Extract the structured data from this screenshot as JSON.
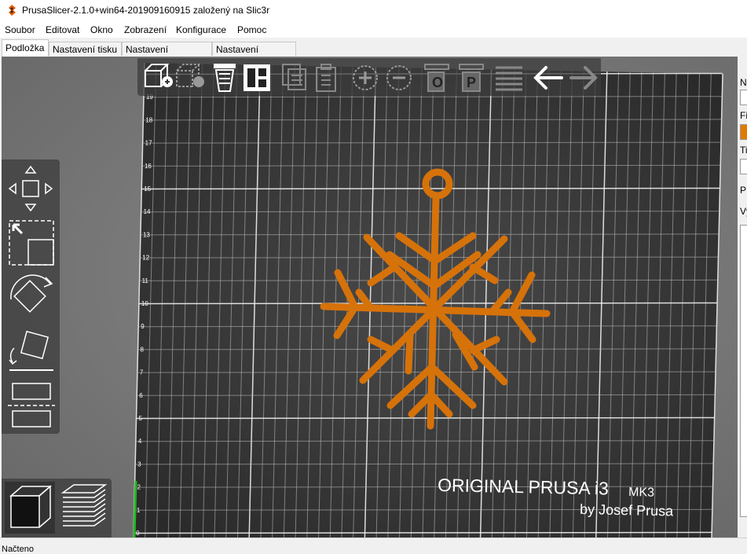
{
  "window": {
    "title": "PrusaSlicer-2.1.0+win64-201909160915 založený na Slic3r",
    "app_icon": "prusaslicer-logo-icon"
  },
  "menu": [
    "Soubor",
    "Editovat",
    "Okno",
    "Zobrazení",
    "Konfigurace",
    "Pomoc"
  ],
  "tabs": [
    {
      "label": "Podložka",
      "active": true
    },
    {
      "label": "Nastavení tisku",
      "active": false
    },
    {
      "label": "Nastavení filamentu",
      "active": false
    },
    {
      "label": "Nastavení tiskárny",
      "active": false
    }
  ],
  "bed": {
    "logo_main": "ORIGINAL PRUSA i3",
    "logo_model": "MK3",
    "logo_sub": "by Josef Prusa",
    "y_ticks": [
      "0",
      "1",
      "2",
      "3",
      "4",
      "5",
      "6",
      "7",
      "8",
      "9",
      "10",
      "11",
      "12",
      "13",
      "14",
      "15",
      "16",
      "17",
      "18",
      "19"
    ]
  },
  "top_toolbar": [
    "add-icon",
    "delete-icon",
    "delete-all-icon",
    "arrange-icon",
    "copy-icon",
    "paste-icon",
    "add-instance-icon",
    "remove-instance-icon",
    "split-objects-icon",
    "split-parts-icon",
    "layer-editing-icon",
    "undo-icon",
    "redo-icon"
  ],
  "left_toolbar": [
    "move-icon",
    "scale-icon",
    "rotate-icon",
    "place-on-face-icon",
    "cut-icon"
  ],
  "view_toolbar": [
    "3d-view-icon",
    "preview-layers-icon"
  ],
  "model": {
    "name": "snowflake",
    "color": "#e07b00"
  },
  "right_panel_labels": [
    "N",
    "Fi",
    "Ti",
    "P",
    "Vý"
  ],
  "status": "Načteno"
}
